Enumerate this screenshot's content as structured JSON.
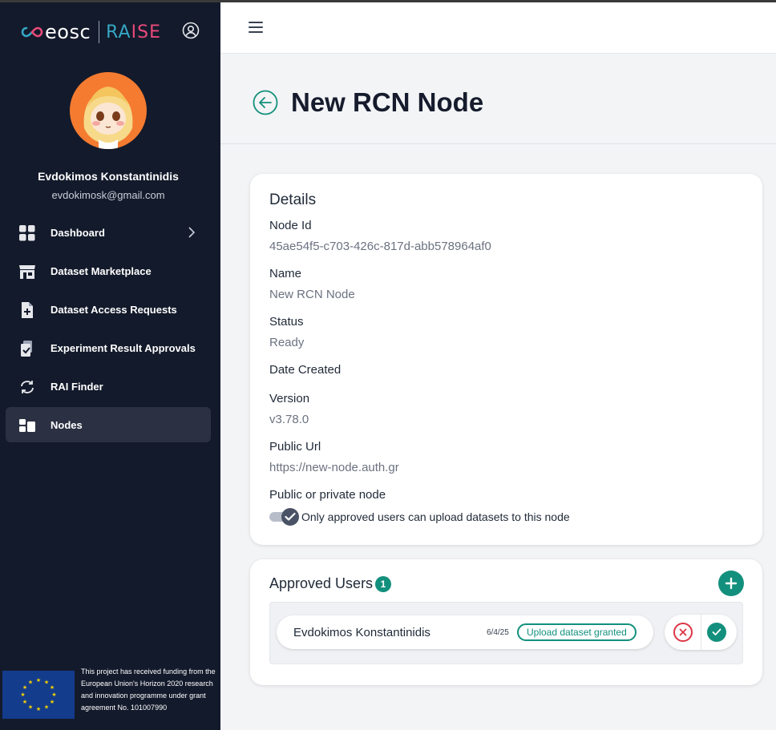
{
  "brand": {
    "eosc": "eosc",
    "raise_part1": "RA",
    "raise_part2": "ISE"
  },
  "user": {
    "name": "Evdokimos Konstantinidis",
    "email": "evdokimosk@gmail.com"
  },
  "sidebar": {
    "items": [
      {
        "label": "Dashboard",
        "icon": "grid-icon"
      },
      {
        "label": "Dataset Marketplace",
        "icon": "storefront-icon"
      },
      {
        "label": "Dataset Access Requests",
        "icon": "document-plus-icon"
      },
      {
        "label": "Experiment Result Approvals",
        "icon": "clipboard-check-icon"
      },
      {
        "label": "RAI Finder",
        "icon": "sync-icon"
      },
      {
        "label": "Nodes",
        "icon": "nodes-icon"
      }
    ],
    "active": "Nodes"
  },
  "funding": {
    "text": "This project has received funding from the European Union's Horizon 2020 research and innovation programme under grant agreement No. 101007990"
  },
  "page": {
    "title": "New RCN Node"
  },
  "details": {
    "heading": "Details",
    "node_id_label": "Node Id",
    "node_id": "45ae54f5-c703-426c-817d-abb578964af0",
    "name_label": "Name",
    "name": "New RCN Node",
    "status_label": "Status",
    "status": "Ready",
    "date_created_label": "Date Created",
    "date_created": "",
    "version_label": "Version",
    "version": "v3.78.0",
    "public_url_label": "Public Url",
    "public_url": "https://new-node.auth.gr",
    "visibility_label": "Public or private node",
    "visibility_text": "Only approved users can upload datasets to this node",
    "visibility_private": true
  },
  "approved_users": {
    "heading": "Approved Users",
    "count": "1",
    "items": [
      {
        "name": "Evdokimos Konstantinidis",
        "date": "6/4/25",
        "badge": "Upload dataset granted"
      }
    ]
  },
  "colors": {
    "accent": "#13907d",
    "sidebar": "#131a2b",
    "reject": "#dc3545"
  }
}
